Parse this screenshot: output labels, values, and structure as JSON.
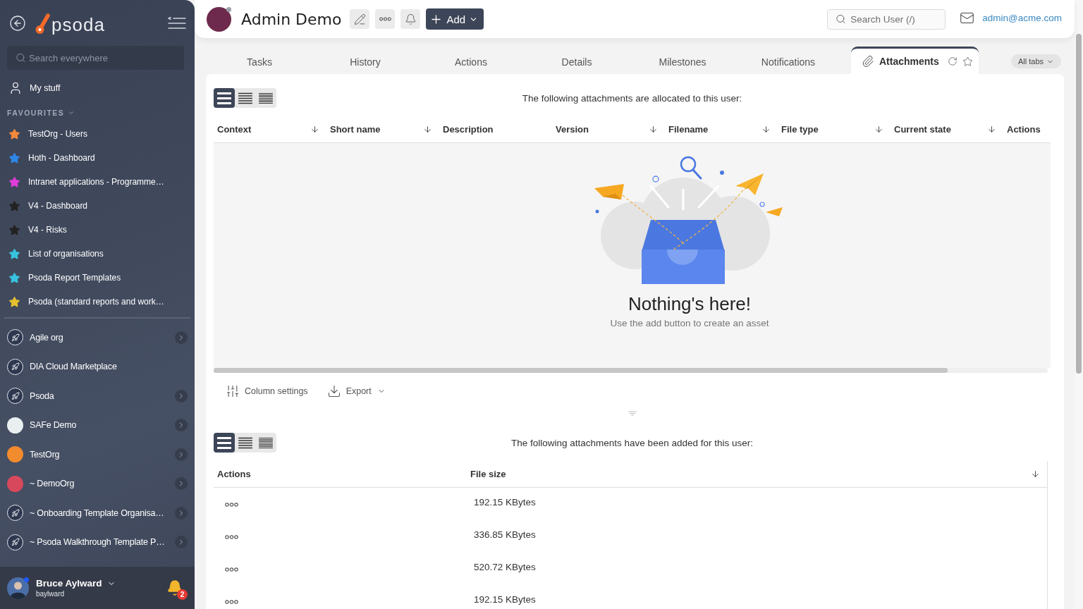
{
  "sidebar": {
    "logo": "psoda",
    "search": {
      "placeholder": "Search everywhere"
    },
    "my_stuff": "My stuff",
    "favourites_heading": "FAVOURITES",
    "favourites": [
      {
        "label": "TestOrg - Users",
        "color": "#f7893b"
      },
      {
        "label": "Hoth - Dashboard",
        "color": "#2f86e8"
      },
      {
        "label": "Intranet applications - Programme…",
        "color": "#e23ddb"
      },
      {
        "label": "V4 - Dashboard",
        "color": "#222222"
      },
      {
        "label": "V4 - Risks",
        "color": "#222222"
      },
      {
        "label": "List of organisations",
        "color": "#38c4e0"
      },
      {
        "label": "Psoda Report Templates",
        "color": "#38c4e0"
      },
      {
        "label": "Psoda (standard reports and work…",
        "color": "#e6c02e"
      }
    ],
    "organisations": [
      {
        "label": "Agile org",
        "kind": "rocket",
        "has_children": true
      },
      {
        "label": "DIA Cloud Marketplace",
        "kind": "rocket",
        "has_children": false
      },
      {
        "label": "Psoda",
        "kind": "rocket",
        "has_children": true
      },
      {
        "label": "SAFe Demo",
        "kind": "logo",
        "color": "#e9eef0",
        "has_children": true
      },
      {
        "label": "TestOrg",
        "kind": "logo",
        "color": "#f28a2e",
        "has_children": true
      },
      {
        "label": "~ DemoOrg",
        "kind": "logo",
        "color": "#d8485c",
        "has_children": true
      },
      {
        "label": "~ Onboarding Template Organisa…",
        "kind": "rocket",
        "has_children": true
      },
      {
        "label": "~ Psoda Walkthrough Template P…",
        "kind": "rocket",
        "has_children": true
      }
    ],
    "user": {
      "name": "Bruce Aylward",
      "username": "baylward",
      "online": true,
      "notifications": "2"
    }
  },
  "header": {
    "title": "Admin Demo",
    "online": false,
    "add_label": "Add",
    "search": {
      "placeholder": "Search User (/)"
    },
    "email": "admin@acme.com"
  },
  "tabs": [
    {
      "label": "Tasks",
      "selected": false
    },
    {
      "label": "History",
      "selected": false
    },
    {
      "label": "Actions",
      "selected": false
    },
    {
      "label": "Details",
      "selected": false
    },
    {
      "label": "Milestones",
      "selected": false
    },
    {
      "label": "Notifications",
      "selected": false
    },
    {
      "label": "Attachments",
      "selected": true
    }
  ],
  "all_tabs": "All tabs",
  "allocated": {
    "views": [
      {
        "kind": "wide",
        "selected": true
      },
      {
        "kind": "medium",
        "selected": false
      },
      {
        "kind": "compact",
        "selected": false
      }
    ],
    "caption": "The following attachments are allocated to this user:",
    "columns": [
      {
        "label": "Context",
        "sortable": true
      },
      {
        "label": "Short name",
        "sortable": true
      },
      {
        "label": "Description",
        "sortable": false
      },
      {
        "label": "Version",
        "sortable": true
      },
      {
        "label": "Filename",
        "sortable": true
      },
      {
        "label": "File type",
        "sortable": true
      },
      {
        "label": "Current state",
        "sortable": true
      },
      {
        "label": "Actions",
        "sortable": false
      }
    ],
    "empty": {
      "title": "Nothing's here!",
      "subtitle": "Use the add button to create an asset"
    }
  },
  "toolbar": {
    "column_settings": "Column settings",
    "export": "Export"
  },
  "added": {
    "views": [
      {
        "kind": "wide",
        "selected": true
      },
      {
        "kind": "medium",
        "selected": false
      },
      {
        "kind": "compact",
        "selected": false
      }
    ],
    "caption": "The following attachments have been added for this user:",
    "columns": [
      {
        "label": "Actions",
        "sortable": false
      },
      {
        "label": "File size",
        "sortable": true
      }
    ],
    "rows": [
      {
        "file_size": "192.15 KBytes"
      },
      {
        "file_size": "336.85 KBytes"
      },
      {
        "file_size": "520.72 KBytes"
      },
      {
        "file_size": "192.15 KBytes"
      }
    ]
  }
}
